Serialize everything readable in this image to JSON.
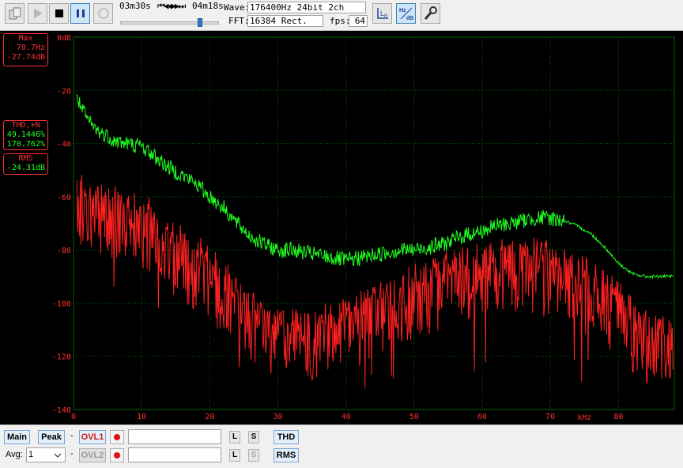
{
  "toolbar": {
    "elapsed": "03m30s",
    "skip_glyphs": "⏮◀◀▶▶⏭",
    "total": "04m18s",
    "position_fraction": 0.81,
    "wave_label": "Wave:",
    "wave_value": "176400Hz 24bit 2ch",
    "fft_label": "FFT:",
    "fft_value": "16384 Rect.",
    "fps_label": "fps:",
    "fps_value": "64",
    "icons": [
      "copy-icon",
      "play-icon",
      "stop-icon",
      "pause-icon",
      "record-icon",
      "lr-axis-icon",
      "hz-db-icon",
      "settings-wrench-icon"
    ]
  },
  "readouts": {
    "max_title": "Max",
    "max_freq": "70.7Hz",
    "max_level": "-27.74dB",
    "thd_title": "THD,+N",
    "thd_value": "49.1446%",
    "thdn_value": "170.762%",
    "rms_title": "RMS",
    "rms_value": "-24.31dB"
  },
  "chart_data": {
    "type": "line",
    "title": "",
    "xlabel": "kHz",
    "ylabel": "",
    "x_ticks": [
      0,
      10,
      20,
      30,
      40,
      50,
      60,
      70,
      80
    ],
    "y_ticks": [
      "0dB",
      "-20",
      "-40",
      "-60",
      "-80",
      "-100",
      "-120",
      "-140"
    ],
    "xlim": [
      0,
      88.2
    ],
    "ylim": [
      -140,
      0
    ],
    "grid": true,
    "colors": {
      "peak": "#ff2020",
      "spectrum": "#20ff20",
      "grid": "#006400",
      "axis_text": "#ff3030"
    },
    "series": [
      {
        "x": [
          0.5,
          1,
          2,
          3,
          4,
          5,
          6,
          8,
          10,
          12,
          14,
          16,
          18,
          20,
          22,
          24,
          26,
          28,
          30,
          32,
          34,
          36,
          38,
          40,
          42,
          44,
          46,
          48,
          50,
          52,
          54,
          56,
          58,
          60,
          62,
          64,
          66,
          68,
          70,
          72,
          74,
          76,
          78,
          80,
          82,
          84,
          86,
          88
        ],
        "values": [
          -22,
          -26,
          -31,
          -34,
          -36,
          -37,
          -39,
          -40,
          -41,
          -45,
          -49,
          -52,
          -55,
          -60,
          -64,
          -70,
          -75,
          -78,
          -80,
          -80,
          -81,
          -82,
          -83,
          -84,
          -83,
          -82,
          -81,
          -80,
          -80,
          -79,
          -78,
          -76,
          -74,
          -73,
          -71,
          -70,
          -69,
          -68,
          -68,
          -69,
          -71,
          -74,
          -79,
          -85,
          -89,
          -90,
          -90,
          -90
        ]
      },
      {
        "x": [
          0.5,
          1,
          2,
          3,
          4,
          5,
          6,
          8,
          10,
          12,
          14,
          16,
          18,
          20,
          22,
          24,
          26,
          28,
          30,
          32,
          34,
          36,
          38,
          40,
          42,
          44,
          46,
          48,
          50,
          52,
          54,
          56,
          58,
          60,
          62,
          64,
          66,
          68,
          70,
          72,
          74,
          76,
          78,
          80,
          82,
          84,
          86,
          88
        ],
        "values": [
          -50,
          -58,
          -62,
          -65,
          -64,
          -65,
          -65,
          -66,
          -67,
          -70,
          -74,
          -79,
          -83,
          -87,
          -92,
          -98,
          -104,
          -108,
          -110,
          -111,
          -111,
          -110,
          -108,
          -106,
          -104,
          -102,
          -99,
          -96,
          -94,
          -92,
          -90,
          -88,
          -87,
          -86,
          -85,
          -84,
          -84,
          -84,
          -85,
          -87,
          -90,
          -93,
          -96,
          -100,
          -106,
          -110,
          -113,
          -115
        ]
      }
    ]
  },
  "bottom": {
    "main_label": "Main",
    "peak_label": "Peak",
    "dash": "-",
    "ovl1_label": "OVL1",
    "ovl2_label": "OVL2",
    "l_label": "L",
    "s_label": "S",
    "thd_label": "THD",
    "rms_label": "RMS",
    "avg_label": "Avg:",
    "avg_value": "1"
  }
}
